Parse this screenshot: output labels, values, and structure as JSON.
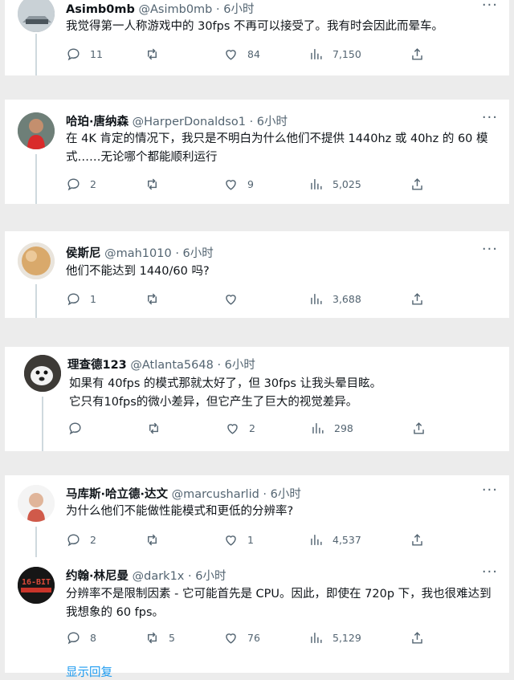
{
  "tweets": [
    {
      "name": "Asimb0mb",
      "handle": "@Asimb0mb",
      "sep": "·",
      "time": "6小时",
      "text": "我觉得第一人称游戏中的 30fps 不再可以接受了。我有时会因此而晕车。",
      "replies": "11",
      "retweets": "",
      "likes": "84",
      "views": "7,150",
      "avatar_icon": "car-photo-avatar"
    },
    {
      "name": "哈珀·唐纳森",
      "handle": "@HarperDonaldso1",
      "sep": "·",
      "time": "6小时",
      "text": "在 4K 肯定的情况下，我只是不明白为什么他们不提供 1440hz 或 40hz 的 60 模式……无论哪个都能顺利运行",
      "replies": "2",
      "retweets": "",
      "likes": "9",
      "views": "5,025",
      "avatar_icon": "person-red-shirt-avatar"
    },
    {
      "name": "侯斯尼",
      "handle": "@mah1010",
      "sep": "·",
      "time": "6小时",
      "text": "他们不能达到 1440/60 吗?",
      "replies": "1",
      "retweets": "",
      "likes": "",
      "views": "3,688",
      "avatar_icon": "planet-avatar"
    },
    {
      "name": "理查德123",
      "handle": "@Atlanta5648",
      "sep": "·",
      "time": "6小时",
      "text": "如果有 40fps 的模式那就太好了，但 30fps 让我头晕目眩。",
      "text2": "它只有10fps的微小差异，但它产生了巨大的视觉差异。",
      "replies": "",
      "retweets": "",
      "likes": "2",
      "views": "298",
      "avatar_icon": "dog-avatar"
    },
    {
      "name": "马库斯·哈立德·达文",
      "handle": "@marcusharlid",
      "sep": "·",
      "time": "6小时",
      "text": "为什么他们不能做性能模式和更低的分辨率?",
      "replies": "2",
      "retweets": "",
      "likes": "1",
      "views": "4,537",
      "avatar_icon": "bald-man-avatar"
    },
    {
      "name": "约翰·林尼曼",
      "handle": "@dark1x",
      "sep": "·",
      "time": "6小时",
      "text": "分辨率不是限制因素 - 它可能首先是 CPU。因此，即使在 720p 下，我也很难达到我想象的 60 fps。",
      "replies": "8",
      "retweets": "5",
      "likes": "76",
      "views": "5,129",
      "avatar_icon": "16-bit-logo-avatar"
    }
  ],
  "show_replies": "显示回复",
  "colors": {
    "accent": "#1d9bf0",
    "muted": "#536471",
    "text": "#0f1419",
    "background": "#ececec"
  }
}
